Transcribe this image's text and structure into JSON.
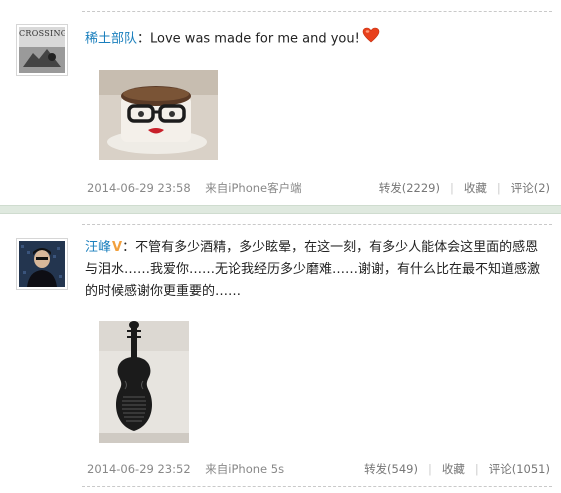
{
  "posts": [
    {
      "username": "稀土部队",
      "text": "：Love was made for me and you!",
      "emoji": "heart-emoji",
      "timestamp": "2014-06-29 23:58",
      "source": "来自iPhone客户端",
      "repost": "转发(2229)",
      "favorite": "收藏",
      "comment": "评论(2)",
      "avatar_caption": "CROSSING",
      "image_desc": "cake-photo"
    },
    {
      "username": "汪峰",
      "verified": "V",
      "text": "：不管有多少酒精，多少眩晕，在这一刻，有多少人能体会这里面的感恩与泪水……我爱你……无论我经历多少磨难……谢谢，有什么比在最不知道感激的时候感谢你更重要的……",
      "timestamp": "2014-06-29 23:52",
      "source": "来自iPhone 5s",
      "repost": "转发(549)",
      "favorite": "收藏",
      "comment": "评论(1051)",
      "image_desc": "violin-photo"
    }
  ],
  "colors": {
    "username": "#1a7fbd",
    "verified": "#f2a03d",
    "separator": "#dfe9df",
    "meta_text": "#888888"
  }
}
